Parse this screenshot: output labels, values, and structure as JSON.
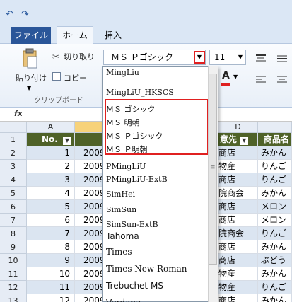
{
  "qat": {
    "undo_icon": "undo-icon",
    "redo_icon": "redo-icon"
  },
  "tabs": {
    "file": "ファイル",
    "home": "ホーム",
    "insert": "挿入"
  },
  "ribbon": {
    "paste_label": "貼り付け",
    "cut_label": "切り取り",
    "copy_label": "コピー",
    "clipboard_group": "クリップボード",
    "font_name": "ＭＳ Ｐゴシック",
    "font_size": "11",
    "font_color_letter": "A"
  },
  "formula": {
    "fx": "fx"
  },
  "columns": {
    "a": "A",
    "d": "D"
  },
  "header_row": {
    "no": "No.",
    "e": "意先",
    "f": "商品名"
  },
  "rows": [
    {
      "n": "2",
      "a": "1",
      "b": "2009",
      "e": "商店",
      "f": "みかん"
    },
    {
      "n": "3",
      "a": "2",
      "b": "2009",
      "e": "物産",
      "f": "りんご"
    },
    {
      "n": "4",
      "a": "3",
      "b": "2009",
      "e": "商店",
      "f": "りんご"
    },
    {
      "n": "5",
      "a": "4",
      "b": "2009",
      "e": "院商会",
      "f": "みかん"
    },
    {
      "n": "6",
      "a": "5",
      "b": "2009",
      "e": "商店",
      "f": "メロン"
    },
    {
      "n": "7",
      "a": "6",
      "b": "2009",
      "e": "商店",
      "f": "メロン"
    },
    {
      "n": "8",
      "a": "7",
      "b": "2009",
      "e": "院商会",
      "f": "りんご"
    },
    {
      "n": "9",
      "a": "8",
      "b": "2009",
      "e": "商店",
      "f": "みかん"
    },
    {
      "n": "10",
      "a": "9",
      "b": "2009",
      "e": "商店",
      "f": "ぶどう"
    },
    {
      "n": "11",
      "a": "10",
      "b": "2009",
      "e": "物産",
      "f": "みかん"
    },
    {
      "n": "12",
      "a": "11",
      "b": "2009",
      "e": "物産",
      "f": "りんご"
    },
    {
      "n": "13",
      "a": "12",
      "b": "2009",
      "e": "商店",
      "f": "みかん"
    }
  ],
  "row1_label": "1",
  "fonts": [
    "MingLiu",
    "MingLiU_HKSCS",
    "ＭＳ ゴシック",
    "ＭＳ 明朝",
    "ＭＳ Ｐゴシック",
    "ＭＳ Ｐ明朝",
    "PMingLiU",
    "PMingLiU-ExtB",
    "SimHei",
    "SimSun",
    "SimSun-ExtB",
    "Tahoma",
    "Times",
    "Times New Roman",
    "Trebuchet MS",
    "Verdana"
  ],
  "colors": {
    "header_green": "#4f6228",
    "band_blue": "#dbe5f1",
    "highlight_red": "#e02020",
    "file_tab": "#2a5699"
  }
}
